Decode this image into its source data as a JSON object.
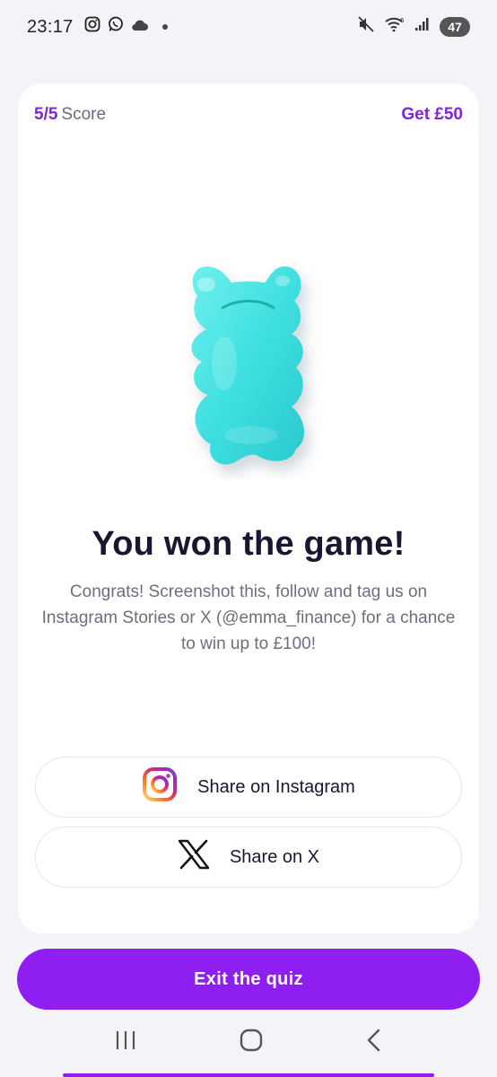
{
  "status_bar": {
    "time": "23:17",
    "battery": "47",
    "icons_left": [
      "instagram-icon",
      "whatsapp-icon",
      "cloud-icon",
      "dot-icon"
    ],
    "icons_right": [
      "mute-icon",
      "wifi-icon",
      "signal-icon",
      "battery-icon"
    ]
  },
  "header": {
    "score_value": "5/5",
    "score_label": "Score",
    "reward_link": "Get £50"
  },
  "result": {
    "headline": "You won the game!",
    "message": "Congrats! Screenshot this, follow and tag us on Instagram Stories or X (@emma_finance) for a chance to win up to £100!"
  },
  "share": {
    "instagram_label": "Share on Instagram",
    "x_label": "Share on X"
  },
  "footer": {
    "exit_label": "Exit the quiz"
  },
  "colors": {
    "accent": "#8f1ff1",
    "accent_text": "#7f27d6",
    "bear": "#3fe0e0",
    "background": "#f4f3f7"
  },
  "nav": {
    "icons": [
      "recent-apps-icon",
      "home-icon",
      "back-icon"
    ]
  }
}
